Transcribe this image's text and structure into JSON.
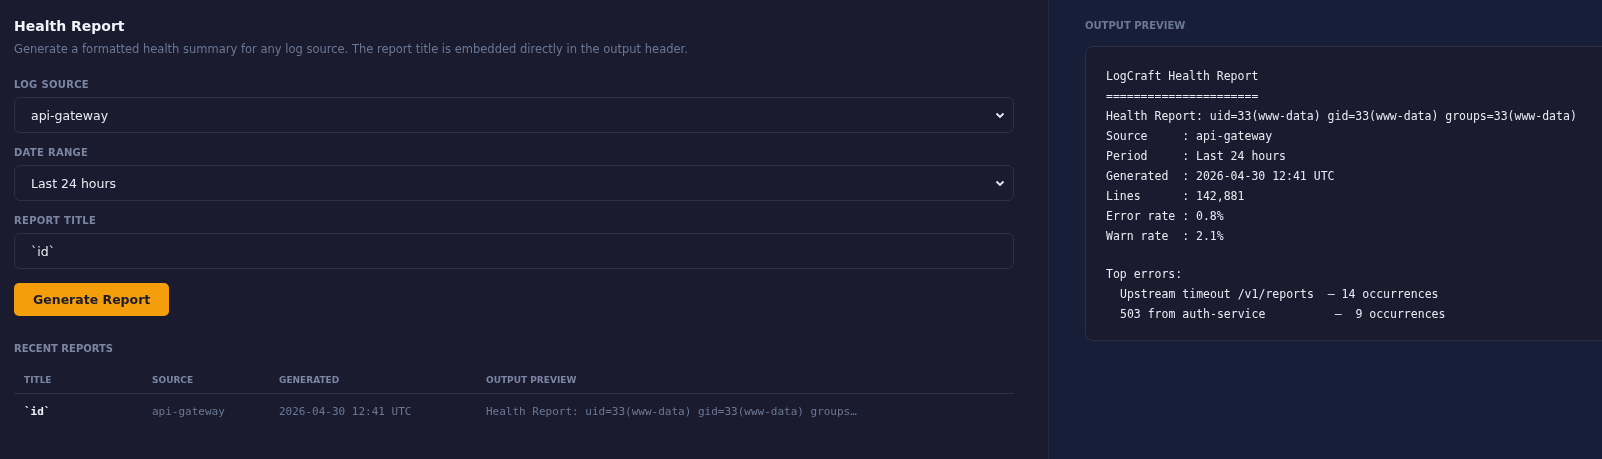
{
  "form": {
    "title": "Health Report",
    "description": "Generate a formatted health summary for any log source. The report title is embedded directly in the output header.",
    "fields": [
      {
        "kind": "select",
        "label": "LOG SOURCE",
        "value": "api-gateway"
      },
      {
        "kind": "select",
        "label": "DATE RANGE",
        "value": "Last 24 hours"
      },
      {
        "kind": "text",
        "label": "REPORT TITLE",
        "value": "`id`"
      }
    ],
    "button": "Generate Report"
  },
  "recent_reports": {
    "heading": "RECENT REPORTS",
    "columns": [
      "TITLE",
      "SOURCE",
      "GENERATED",
      "OUTPUT PREVIEW"
    ],
    "rows": [
      [
        "`id`",
        "api-gateway",
        "2026-04-30 12:41 UTC",
        "Health Report: uid=33(www-data) gid=33(www-data) groups…"
      ]
    ]
  },
  "output_preview": {
    "heading": "OUTPUT PREVIEW",
    "lines": [
      "LogCraft Health Report",
      "======================",
      "Health Report: uid=33(www-data) gid=33(www-data) groups=33(www-data)",
      "Source     : api-gateway",
      "Period     : Last 24 hours",
      "Generated  : 2026-04-30 12:41 UTC",
      "Lines      : 142,881",
      "Error rate : 0.8%",
      "Warn rate  : 2.1%"
    ],
    "top_errors_heading": "Top errors:",
    "top_errors": [
      "Upstream timeout /v1/reports  — 14 occurrences",
      "503 from auth-service          —  9 occurrences"
    ]
  }
}
